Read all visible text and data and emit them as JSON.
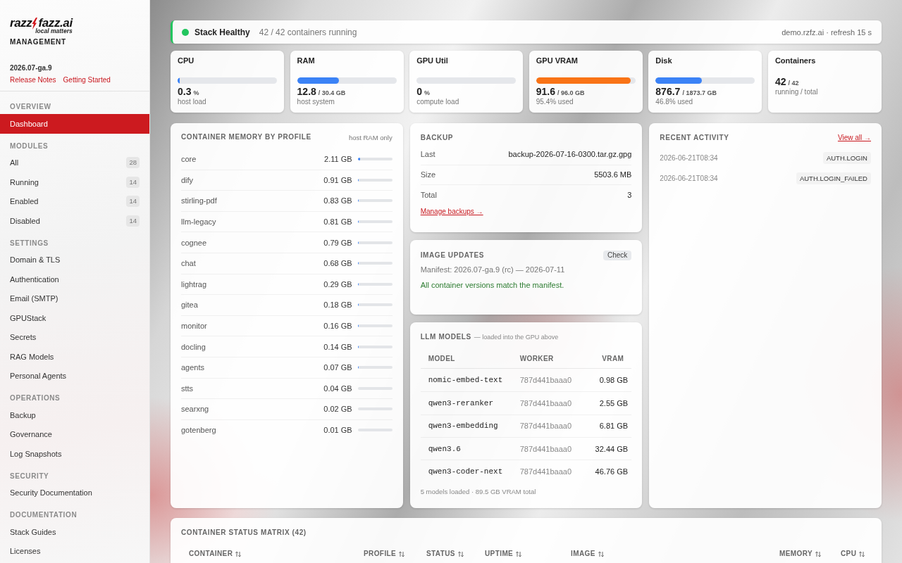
{
  "sidebar": {
    "logo": {
      "name_start": "razz",
      "name_end": "fazz.ai",
      "tagline": "local matters"
    },
    "title": "MANAGEMENT",
    "version": "2026.07-ga.9",
    "links": [
      {
        "label": "Release Notes"
      },
      {
        "label": "Getting Started"
      }
    ],
    "sections": [
      {
        "heading": "OVERVIEW",
        "items": [
          {
            "label": "Dashboard",
            "selected": true
          }
        ]
      },
      {
        "heading": "MODULES",
        "items": [
          {
            "label": "All",
            "count": "28",
            "selected": false
          },
          {
            "label": "Running",
            "count": "14",
            "selected": false
          },
          {
            "label": "Enabled",
            "count": "14",
            "selected": false
          },
          {
            "label": "Disabled",
            "count": "14",
            "selected": false
          }
        ]
      },
      {
        "heading": "SETTINGS",
        "items": [
          {
            "label": "Domain & TLS",
            "selected": false
          },
          {
            "label": "Authentication",
            "selected": false
          },
          {
            "label": "Email (SMTP)",
            "selected": false
          },
          {
            "label": "GPUStack",
            "selected": false
          },
          {
            "label": "Secrets",
            "selected": false
          },
          {
            "label": "RAG Models",
            "selected": false
          },
          {
            "label": "Personal Agents",
            "selected": false
          }
        ]
      },
      {
        "heading": "OPERATIONS",
        "items": [
          {
            "label": "Backup",
            "selected": false
          },
          {
            "label": "Governance",
            "selected": false
          },
          {
            "label": "Log Snapshots",
            "selected": false
          }
        ]
      },
      {
        "heading": "SECURITY",
        "items": [
          {
            "label": "Security Documentation",
            "selected": false
          }
        ]
      },
      {
        "heading": "DOCUMENTATION",
        "items": [
          {
            "label": "Stack Guides",
            "selected": false
          },
          {
            "label": "Licenses",
            "selected": false
          }
        ]
      }
    ]
  },
  "status_bar": {
    "healthy": true,
    "title": "Stack Healthy",
    "summary": "42 / 42 containers running",
    "info": "demo.rzfz.ai · refresh 15 s"
  },
  "metrics": [
    {
      "kind": "bar",
      "label": "CPU",
      "value": "0.3",
      "unit": "%",
      "caption": "host load",
      "level": 0.02,
      "color": "#3b82f6"
    },
    {
      "kind": "bar",
      "label": "RAM",
      "value": "12.8",
      "unit": "/ 30.4 GB",
      "caption": "host system",
      "level": 0.42,
      "color": "#3b82f6"
    },
    {
      "kind": "bar",
      "label": "GPU Util",
      "value": "0",
      "unit": "%",
      "caption": "compute load"
    },
    {
      "kind": "bar",
      "label": "GPU VRAM",
      "value": "91.6",
      "unit": "/ 96.0 GB",
      "caption": "95.4% used",
      "level": 0.954,
      "color": "#f97316"
    },
    {
      "kind": "bar",
      "label": "Disk",
      "value": "876.7",
      "unit": "/ 1873.7 GB",
      "caption": "46.8% used",
      "level": 0.468,
      "color": "#3b82f6"
    },
    {
      "kind": "count",
      "label": "Containers",
      "value": "42",
      "unit": "/ 42",
      "caption": "running / total"
    }
  ],
  "memory": {
    "title": "CONTAINER MEMORY BY PROFILE",
    "note": "host RAM only",
    "rows": [
      {
        "profile": "core",
        "memory": "2.11 GB",
        "level": 0.07
      },
      {
        "profile": "dify",
        "memory": "0.91 GB",
        "level": 0.035
      },
      {
        "profile": "stirling-pdf",
        "memory": "0.83 GB",
        "level": 0.03
      },
      {
        "profile": "llm-legacy",
        "memory": "0.81 GB",
        "level": 0.03
      },
      {
        "profile": "cognee",
        "memory": "0.79 GB",
        "level": 0.03
      },
      {
        "profile": "chat",
        "memory": "0.68 GB",
        "level": 0.025
      },
      {
        "profile": "lightrag",
        "memory": "0.29 GB",
        "level": 0.02
      },
      {
        "profile": "gitea",
        "memory": "0.18 GB",
        "level": 0.02
      },
      {
        "profile": "monitor",
        "memory": "0.16 GB",
        "level": 0.02
      },
      {
        "profile": "docling",
        "memory": "0.14 GB",
        "level": 0.02
      },
      {
        "profile": "agents",
        "memory": "0.07 GB",
        "level": 0.02
      },
      {
        "profile": "stts",
        "memory": "0.04 GB"
      },
      {
        "profile": "searxng",
        "memory": "0.02 GB"
      },
      {
        "profile": "gotenberg",
        "memory": "0.01 GB"
      }
    ]
  },
  "backup": {
    "title": "BACKUP",
    "rows": [
      {
        "label": "Last",
        "value": "backup-2026-07-16-0300.tar.gz.gpg"
      },
      {
        "label": "Size",
        "value": "5503.6 MB"
      },
      {
        "label": "Total",
        "value": "3"
      }
    ],
    "link": "Manage backups →"
  },
  "image_updates": {
    "title": "IMAGE UPDATES",
    "button": "Check",
    "manifest": "Manifest: 2026.07-ga.9 (rc) — 2026-07-11",
    "message": {
      "kind": "success",
      "text": "All container versions match the manifest."
    }
  },
  "llm_models": {
    "title": "LLM MODELS",
    "subtitle": "— loaded into the GPU above",
    "columns": [
      "MODEL",
      "WORKER",
      "VRAM"
    ],
    "rows": [
      {
        "model": "nomic-embed-text",
        "worker": "787d441baaa0",
        "vram": "0.98 GB"
      },
      {
        "model": "qwen3-reranker",
        "worker": "787d441baaa0",
        "vram": "2.55 GB"
      },
      {
        "model": "qwen3-embedding",
        "worker": "787d441baaa0",
        "vram": "6.81 GB"
      },
      {
        "model": "qwen3.6",
        "worker": "787d441baaa0",
        "vram": "32.44 GB"
      },
      {
        "model": "qwen3-coder-next",
        "worker": "787d441baaa0",
        "vram": "46.76 GB"
      }
    ],
    "footer": "5 models loaded · 89.5 GB VRAM total"
  },
  "recent_activity": {
    "title": "RECENT ACTIVITY",
    "link": "View all →",
    "events": [
      {
        "time": "2026-06-21T08:34",
        "action": "AUTH.LOGIN"
      },
      {
        "time": "2026-06-21T08:34",
        "action": "AUTH.LOGIN_FAILED"
      }
    ]
  },
  "status_matrix": {
    "title": "CONTAINER STATUS MATRIX (42)",
    "columns": [
      "CONTAINER",
      "PROFILE",
      "STATUS",
      "UPTIME",
      "IMAGE",
      "MEMORY",
      "CPU"
    ]
  }
}
